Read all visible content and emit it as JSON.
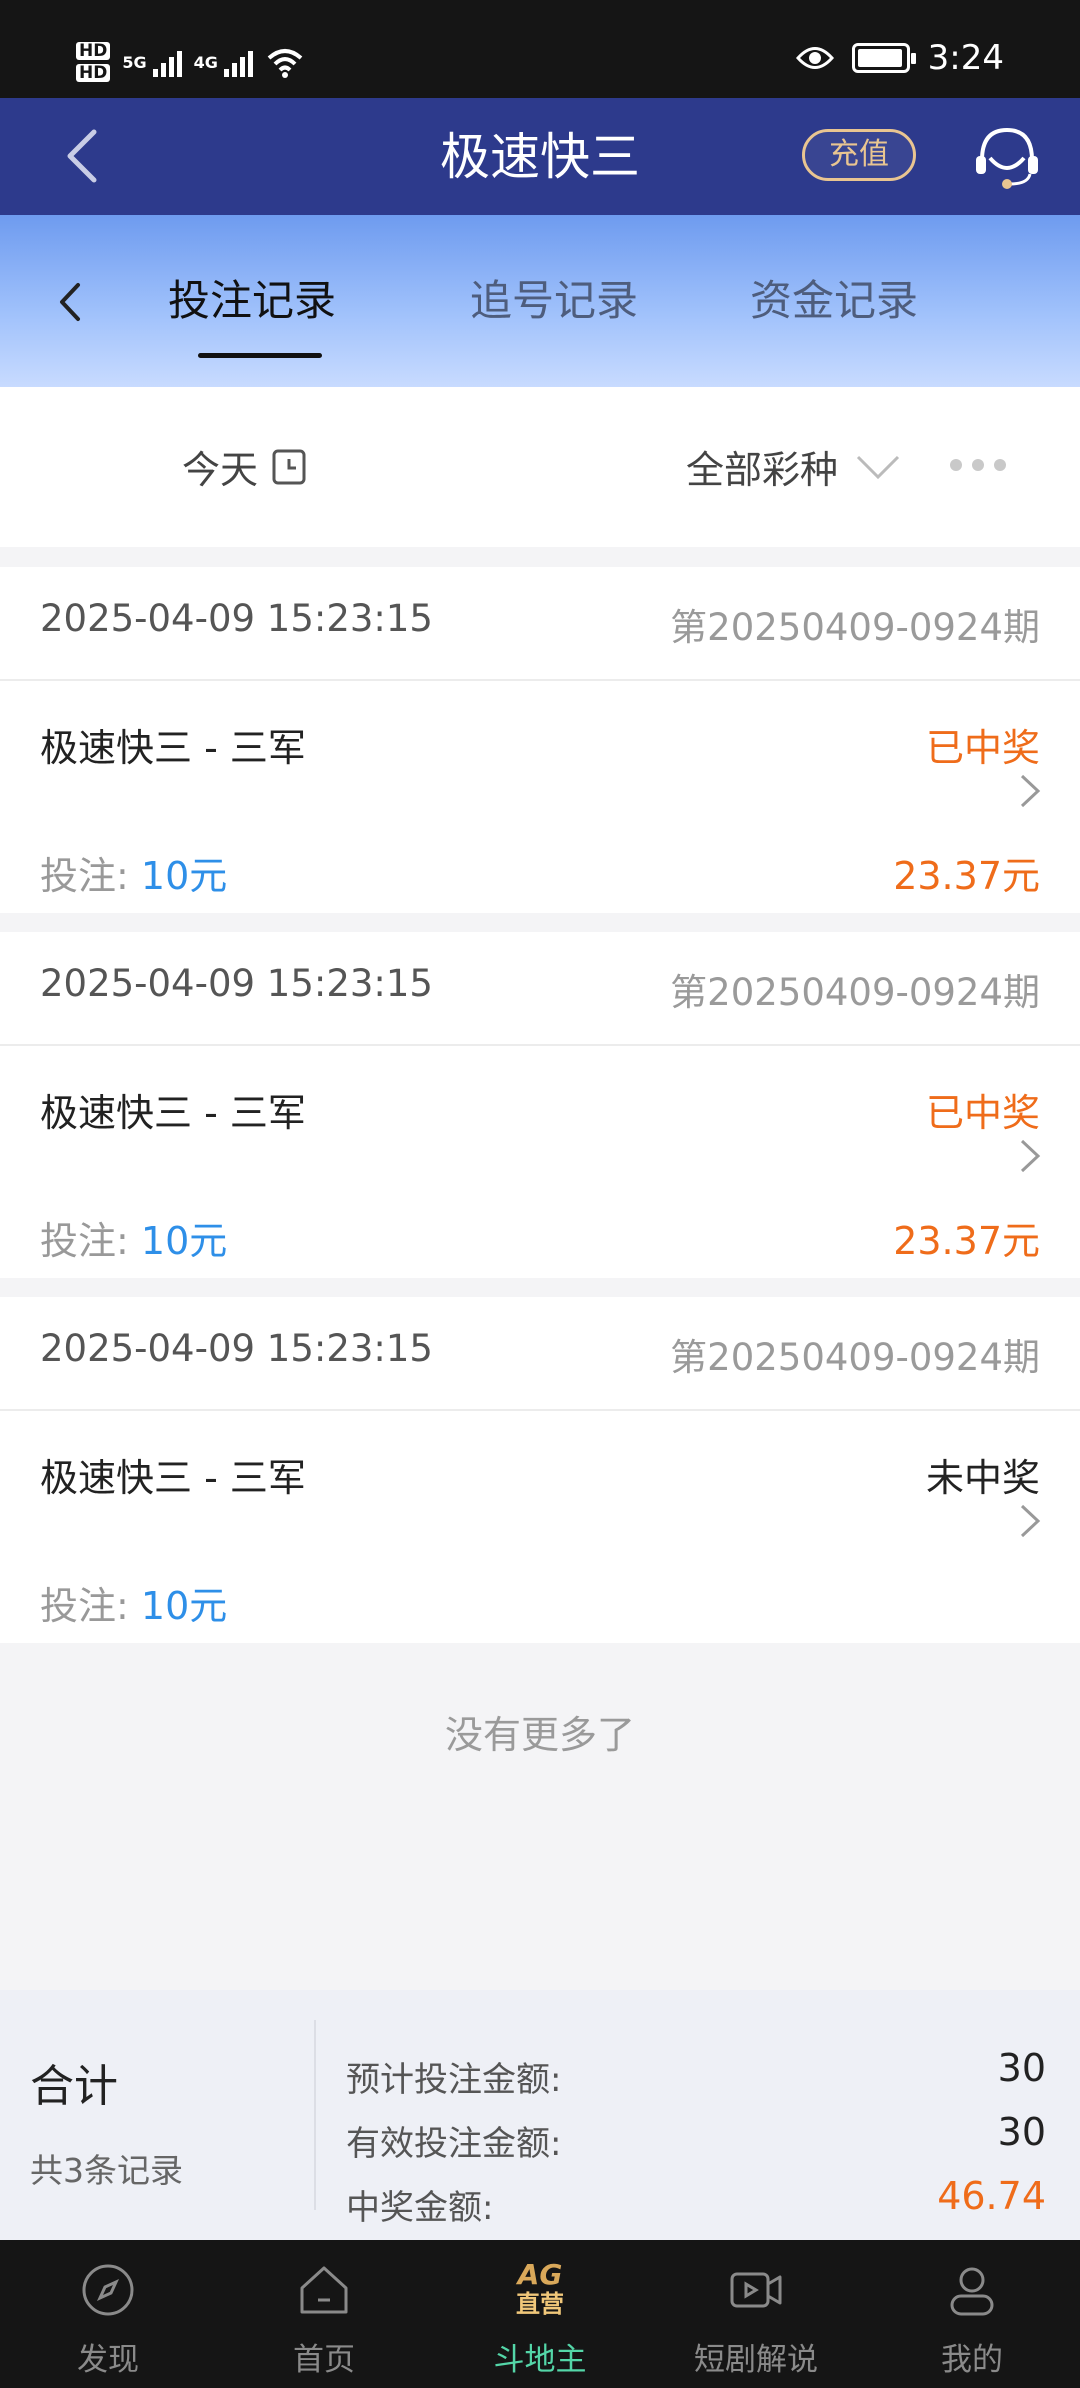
{
  "status_bar": {
    "time": "3:24",
    "network1": "5G",
    "network2": "4G",
    "hd1": "HD",
    "hd2": "HD"
  },
  "header": {
    "title": "极速快三",
    "recharge": "充值"
  },
  "tabs": [
    {
      "label": "投注记录",
      "active": true
    },
    {
      "label": "追号记录",
      "active": false
    },
    {
      "label": "资金记录",
      "active": false
    }
  ],
  "filter": {
    "date": "今天",
    "kind": "全部彩种"
  },
  "records": [
    {
      "datetime": "2025-04-09 15:23:15",
      "issue": "第20250409-0924期",
      "name": "极速快三 - 三军",
      "status": "已中奖",
      "bet_label": "投注: ",
      "bet_amount": "10元",
      "win_amount": "23.37元"
    },
    {
      "datetime": "2025-04-09 15:23:15",
      "issue": "第20250409-0924期",
      "name": "极速快三 - 三军",
      "status": "已中奖",
      "bet_label": "投注: ",
      "bet_amount": "10元",
      "win_amount": "23.37元"
    },
    {
      "datetime": "2025-04-09 15:23:15",
      "issue": "第20250409-0924期",
      "name": "极速快三 - 三军",
      "status": "未中奖",
      "bet_label": "投注: ",
      "bet_amount": "10元",
      "win_amount": ""
    }
  ],
  "no_more": "没有更多了",
  "summary": {
    "title": "合计",
    "count": "共3条记录",
    "rows": [
      {
        "label": "预计投注金额:",
        "value": "30"
      },
      {
        "label": "有效投注金额:",
        "value": "30"
      },
      {
        "label": "中奖金额:",
        "value": "46.74"
      }
    ]
  },
  "bottom_nav": [
    {
      "label": "发现",
      "icon": "compass-icon"
    },
    {
      "label": "首页",
      "icon": "home-icon"
    },
    {
      "label": "斗地主",
      "icon": "ag-logo-icon",
      "active": true,
      "logo_top": "AG",
      "logo_bottom": "直营"
    },
    {
      "label": "短剧解说",
      "icon": "video-icon"
    },
    {
      "label": "我的",
      "icon": "profile-icon"
    }
  ],
  "colors": {
    "header_bg": "#2d3a8c",
    "win": "#ef6c1a",
    "bet_amount": "#2e8fe8",
    "nav_active": "#54d6a8",
    "recharge": "#e9c591"
  }
}
